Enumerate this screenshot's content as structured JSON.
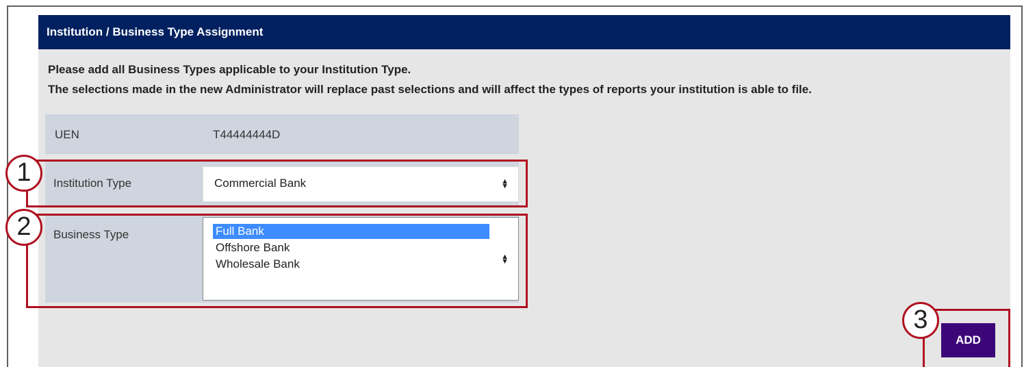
{
  "panel": {
    "title": "Institution / Business Type Assignment",
    "intro_line1": "Please add all Business Types applicable to your Institution Type.",
    "intro_line2": "The selections made in the new Administrator will replace past selections and will affect the types of reports your institution is able to file."
  },
  "uen": {
    "label": "UEN",
    "value": "T44444444D"
  },
  "institution_type": {
    "label": "Institution Type",
    "selected": "Commercial Bank",
    "arrow_icon": "sort-arrows-icon"
  },
  "business_type": {
    "label": "Business Type",
    "options": [
      "Full Bank",
      "Offshore Bank",
      "Wholesale Bank"
    ],
    "selected_index": 0,
    "arrow_icon": "sort-arrows-icon"
  },
  "actions": {
    "add_label": "ADD"
  },
  "callouts": [
    "1",
    "2",
    "3"
  ],
  "colors": {
    "header_bg": "#002060",
    "panel_bg": "#e6e6e6",
    "row_bg": "#cfd5df",
    "selected_option": "#3d8cff",
    "add_button": "#3c0678",
    "callout": "#b01020"
  }
}
